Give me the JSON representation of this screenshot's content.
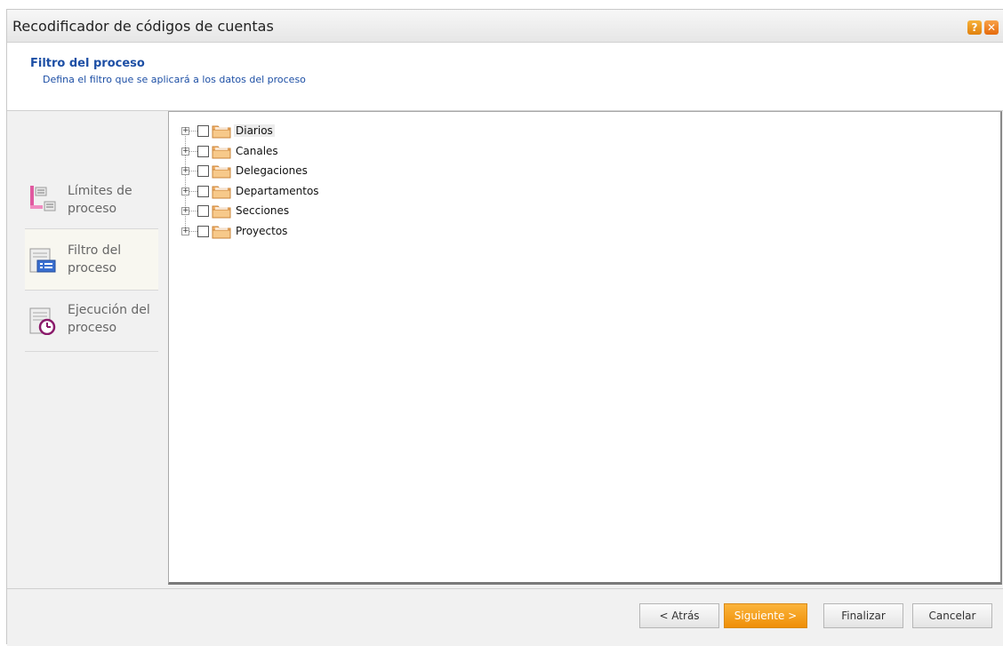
{
  "window": {
    "title": "Recodificador de códigos de cuentas",
    "help_icon": "?",
    "close_icon": "✕"
  },
  "header": {
    "title": "Filtro del proceso",
    "subtitle": "Defina el filtro que se aplicará a los datos del proceso"
  },
  "steps": [
    {
      "line1": "Límites de",
      "line2": "proceso",
      "icon": "limits-icon"
    },
    {
      "line1": "Filtro del",
      "line2": "proceso",
      "icon": "filter-icon",
      "active": true
    },
    {
      "line1": "Ejecución del",
      "line2": "proceso",
      "icon": "execution-icon"
    }
  ],
  "tree": {
    "items": [
      {
        "label": "Diarios",
        "checked": false,
        "selected": true
      },
      {
        "label": "Canales",
        "checked": false
      },
      {
        "label": "Delegaciones",
        "checked": false
      },
      {
        "label": "Departamentos",
        "checked": false
      },
      {
        "label": "Secciones",
        "checked": false
      },
      {
        "label": "Proyectos",
        "checked": false
      }
    ],
    "expander_symbol": "+"
  },
  "footer": {
    "back_label": "< Atrás",
    "next_label": "Siguiente >",
    "finish_label": "Finalizar",
    "cancel_label": "Cancelar"
  },
  "colors": {
    "accent": "#1d4fa5",
    "primary_button": "#f39a12"
  }
}
